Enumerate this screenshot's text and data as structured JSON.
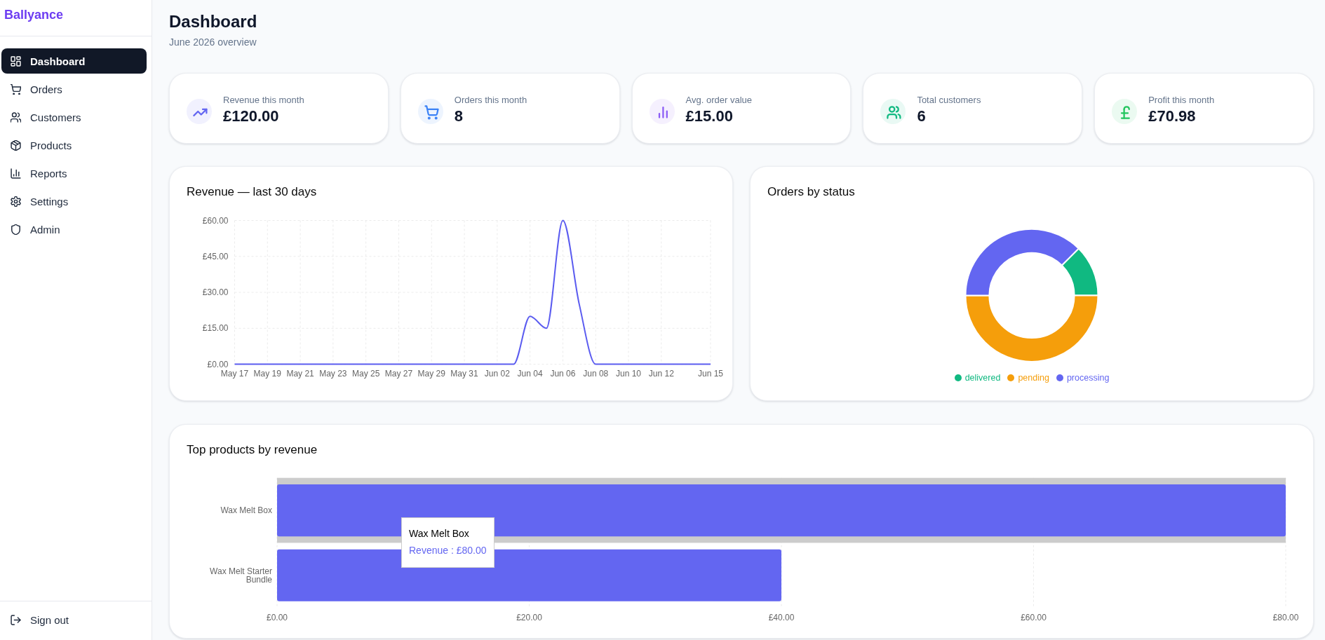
{
  "sidebar": {
    "logo": "Ballyance",
    "items": [
      {
        "kind": "dashboard",
        "label": "Dashboard",
        "selected": true
      },
      {
        "kind": "orders",
        "label": "Orders",
        "selected": false
      },
      {
        "kind": "customers",
        "label": "Customers",
        "selected": false
      },
      {
        "kind": "products",
        "label": "Products",
        "selected": false
      },
      {
        "kind": "reports",
        "label": "Reports",
        "selected": false
      },
      {
        "kind": "settings",
        "label": "Settings",
        "selected": false
      },
      {
        "kind": "admin",
        "label": "Admin",
        "selected": false
      }
    ],
    "sign_out": {
      "label": "Sign out"
    }
  },
  "header": {
    "title": "Dashboard",
    "subtitle": "June 2026 overview"
  },
  "stats": [
    {
      "kind": "revenue",
      "label": "Revenue this month",
      "value": "£120.00",
      "color": "#6366f1"
    },
    {
      "kind": "orders",
      "label": "Orders this month",
      "value": "8",
      "color": "#3b82f6"
    },
    {
      "kind": "average",
      "label": "Avg. order value",
      "value": "£15.00",
      "color": "#8b5cf6"
    },
    {
      "kind": "customers",
      "label": "Total customers",
      "value": "6",
      "color": "#10b981"
    },
    {
      "kind": "profit",
      "label": "Profit this month",
      "value": "£70.98",
      "color": "#22c55e"
    }
  ],
  "revenue_chart": {
    "title": "Revenue — last 30 days",
    "chart_data": {
      "type": "line",
      "categories": [
        "May 17",
        null,
        "May 19",
        null,
        "May 21",
        null,
        "May 23",
        null,
        "May 25",
        null,
        "May 27",
        null,
        "May 29",
        null,
        "May 31",
        null,
        "Jun 02",
        null,
        "Jun 04",
        null,
        "Jun 06",
        null,
        "Jun 08",
        null,
        "Jun 10",
        null,
        "Jun 12",
        null,
        null,
        "Jun 15"
      ],
      "series": [
        {
          "color": "#5b5cf0",
          "values": [
            0,
            0,
            0,
            0,
            0,
            0,
            0,
            0,
            0,
            0,
            0,
            0,
            0,
            0,
            0,
            0,
            0,
            0,
            20,
            15,
            60,
            25,
            0,
            0,
            0,
            0,
            0,
            0,
            0,
            0
          ]
        }
      ],
      "ylim": [
        0,
        60
      ],
      "yticks": [
        {
          "value": 0,
          "label": "£0.00"
        },
        {
          "value": 15,
          "label": "£15.00"
        },
        {
          "value": 30,
          "label": "£30.00"
        },
        {
          "value": 45,
          "label": "£45.00"
        },
        {
          "value": 60,
          "label": "£60.00"
        }
      ],
      "grid": true
    }
  },
  "status_chart": {
    "title": "Orders by status",
    "chart_data": {
      "type": "donut",
      "categories": [
        "delivered",
        "pending",
        "processing"
      ],
      "values": [
        12.5,
        50,
        37.5
      ],
      "legend": "bottom"
    },
    "slices": [
      {
        "color": "#10b981"
      },
      {
        "color": "#f59e0b"
      },
      {
        "color": "#6366f1"
      }
    ]
  },
  "products_chart": {
    "title": "Top products by revenue",
    "chart_data": {
      "type": "bar",
      "orientation": "horizontal",
      "categories": [
        "Wax Melt Box",
        "Wax Melt Starter Bundle"
      ],
      "series": [
        {
          "color": "#6366f1",
          "values": [
            80,
            40
          ]
        }
      ],
      "xlim": [
        0,
        80
      ],
      "xticks": [
        {
          "value": 0,
          "label": "£0.00"
        },
        {
          "value": 20,
          "label": "£20.00"
        },
        {
          "value": 40,
          "label": "£40.00"
        },
        {
          "value": 60,
          "label": "£60.00"
        },
        {
          "value": 80,
          "label": "£80.00"
        }
      ],
      "grid": true,
      "bands": [
        {
          "axis": "y",
          "from": "Wax Melt Box",
          "to": "Wax Melt Box",
          "color": "#cccccc"
        }
      ]
    },
    "tooltip": {
      "title": "Wax Melt Box",
      "text": "Revenue : £80.00"
    }
  }
}
